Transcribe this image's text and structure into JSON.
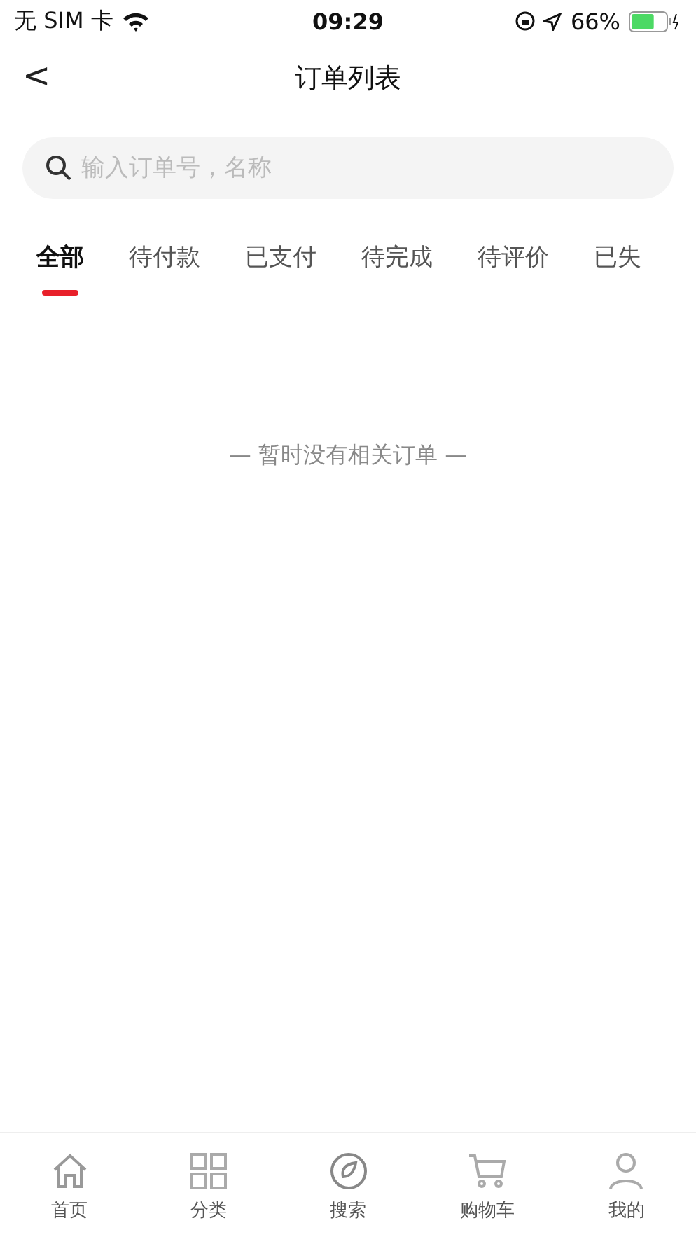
{
  "status_bar": {
    "carrier": "无 SIM 卡",
    "time": "09:29",
    "battery": "66%",
    "battery_icon": {
      "level": 0.66
    }
  },
  "header": {
    "back": "<",
    "title": "订单列表"
  },
  "search": {
    "placeholder": "输入订单号，名称"
  },
  "tabs": [
    {
      "label": "全部",
      "selected": true
    },
    {
      "label": "待付款",
      "selected": false
    },
    {
      "label": "已支付",
      "selected": false
    },
    {
      "label": "待完成",
      "selected": false
    },
    {
      "label": "待评价",
      "selected": false
    },
    {
      "label": "已失",
      "selected": false
    }
  ],
  "empty_message": "— 暂时没有相关订单 —",
  "bottom_nav": [
    {
      "kind": "home",
      "label": "首页"
    },
    {
      "kind": "grid",
      "label": "分类"
    },
    {
      "kind": "compass",
      "label": "搜索"
    },
    {
      "kind": "cart",
      "label": "购物车"
    },
    {
      "kind": "user",
      "label": "我的"
    }
  ]
}
